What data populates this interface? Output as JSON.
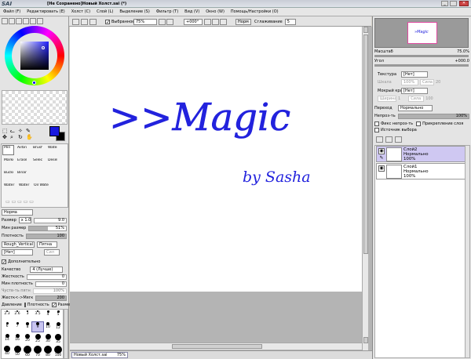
{
  "titlebar": {
    "app": "SAI",
    "title": "[Не Сохранено]Новый Холст.sai (*)"
  },
  "menu": [
    "Файл (F)",
    "Редактировать (E)",
    "Холст (C)",
    "Слой (L)",
    "Выделение (S)",
    "Фильтр (T)",
    "Вид (V)",
    "Окно (W)",
    "Помощь/Настройки (O)"
  ],
  "toolbar": {
    "selection_label": "Выбранное",
    "zoom": "75%",
    "angle": "+000°",
    "norm": "Норм",
    "smoothing_label": "Сглаживание",
    "smoothing": "5"
  },
  "canvas": {
    "text1": ">>Magic",
    "text2": "by Sasha"
  },
  "colors": {
    "ink": "#2222dd",
    "primary": "#1818e0",
    "secondary": "#000000"
  },
  "tools_top": [
    "Pen",
    "Airbrush",
    "Brush",
    "Water"
  ],
  "tools_mid": [
    "Marker",
    "Eraser",
    "Select",
    "Deselect"
  ],
  "tools_bot": [
    "Bucket",
    "Binary"
  ],
  "tools_sizes": [
    "Water 9",
    "Water 10",
    "Oil Water"
  ],
  "tool_options": {
    "mode": "Норма",
    "size_label": "Размер",
    "size_mult": "x 1.0",
    "size_val": "9.0",
    "minsize_label": "Мин размер",
    "minsize_val": "51%",
    "density_label": "Плотность",
    "density_val": "100",
    "texture": "Rough_Vertical",
    "texture_mode": "Пятна",
    "none": "[Нет]",
    "str": "Сил",
    "advanced": "Дополнительно",
    "quality_label": "Качество",
    "quality_val": "4 (Лучше)",
    "hardness_label": "Жесткость",
    "hardness_val": "0",
    "mindensity_label": "Мин плотность",
    "mindensity_val": "0",
    "sens_label": "Чуств-ть пятн",
    "sens_val": "100%",
    "hardsoft_label": "Жестк<->Мягк",
    "hardsoft_val": "200",
    "pressure_label": "Давление",
    "press_density": "Плотность",
    "press_size": "Размер"
  },
  "brush_sizes": [
    "2.3",
    "2.6",
    "3",
    "3.5",
    "4",
    "5",
    "6",
    "7",
    "8",
    "9",
    "10",
    "12",
    "14",
    "16",
    "20",
    "25",
    "30",
    "35",
    "40",
    "50",
    "60",
    "70",
    "80",
    "100"
  ],
  "navigator": {
    "zoom_label": "Масштаб",
    "zoom_val": "75.0%",
    "angle_label": "Угол",
    "angle_val": "+000.0"
  },
  "paper": {
    "texture_label": "Текстура",
    "texture_val": "[Нет]",
    "scale_label": "Шкала",
    "scale_val": "100%",
    "strength_label": "Сила",
    "strength_val": "20",
    "edge_label": "Мокрый край",
    "edge_val": "[Нет]",
    "width_label": "Ширина",
    "width_val": "1",
    "strength2_label": "Сила",
    "strength2_val": "100"
  },
  "layer_opts": {
    "blend_label": "Переход",
    "blend_val": "Нормально",
    "opacity_label": "Непроз-ть",
    "opacity_val": "100%",
    "fix_opacity": "Фикс непроз-ть",
    "clip": "Прикрепление слоя",
    "source": "Источник выбора"
  },
  "layers": [
    {
      "name": "Слой2",
      "mode": "Нормально",
      "opacity": "100%"
    },
    {
      "name": "Слой1",
      "mode": "Нормально",
      "opacity": "100%"
    }
  ],
  "status": {
    "doc": "Новый Холст.sai",
    "zoom": "75%"
  }
}
